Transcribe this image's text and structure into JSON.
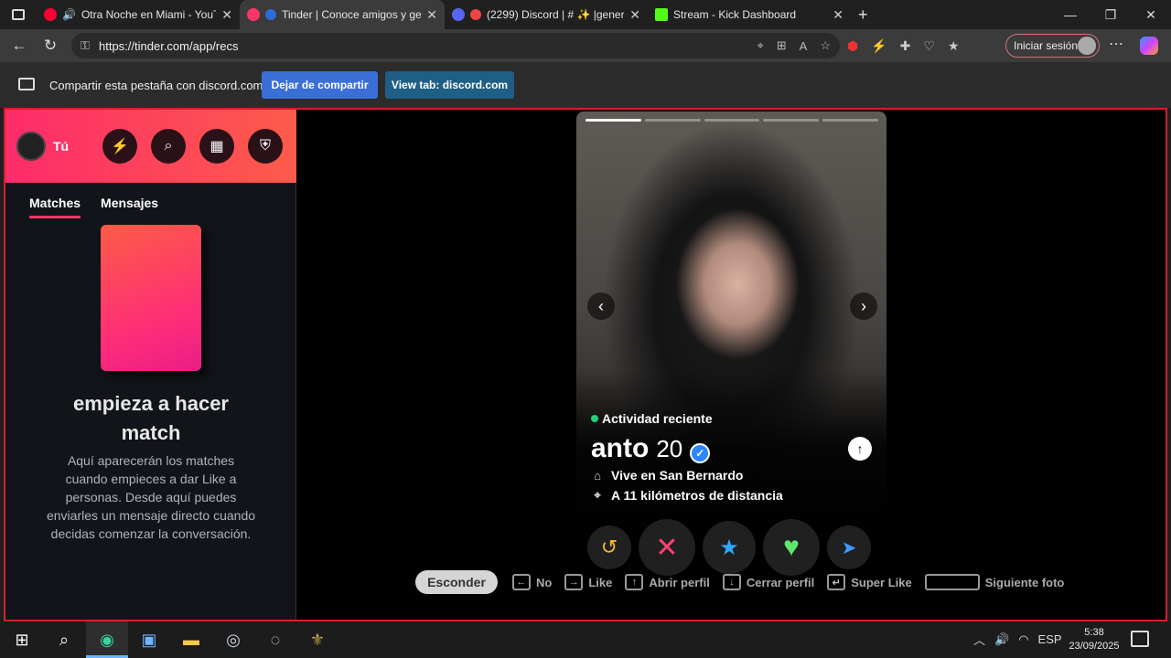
{
  "browser": {
    "tabs": [
      {
        "title": "Otra Noche en Miami - YouT",
        "favicon_color": "#ff0033",
        "active": false
      },
      {
        "title": "Tinder | Conoce amigos y ge",
        "favicon_color": "#fd3566",
        "active": true
      },
      {
        "title": "(2299) Discord | # ✨ |genera",
        "favicon_color": "#5865f2",
        "active": false
      },
      {
        "title": "Stream - Kick Dashboard",
        "favicon_color": "#53fc18",
        "active": false
      }
    ],
    "url": "https://tinder.com/app/recs",
    "signin_label": "Iniciar sesión"
  },
  "sharebar": {
    "text": "Compartir esta pestaña con discord.com",
    "stop_label": "Dejar de compartir",
    "view_label": "View tab: discord.com"
  },
  "sidebar": {
    "me_label": "Tú",
    "tabs": [
      "Matches",
      "Mensajes"
    ],
    "empty_title": "empieza a hacer match",
    "empty_text": "Aquí aparecerán los matches cuando empieces a dar Like a personas. Desde aquí puedes enviarles un mensaje directo cuando decidas comenzar la conversación."
  },
  "profile": {
    "activity": "Actividad reciente",
    "name": "anto",
    "age": "20",
    "lives": "Vive en San Bernardo",
    "distance": "A 11 kilómetros de distancia",
    "photo_count": 5,
    "current_photo": 1
  },
  "shortcuts": {
    "hide": "Esconder",
    "items": [
      {
        "key": "←",
        "label": "No"
      },
      {
        "key": "→",
        "label": "Like"
      },
      {
        "key": "↑",
        "label": "Abrir perfil"
      },
      {
        "key": "↓",
        "label": "Cerrar perfil"
      },
      {
        "key": "↵",
        "label": "Super Like"
      },
      {
        "key": "",
        "label": "Siguiente foto"
      }
    ]
  },
  "taskbar": {
    "lang": "ESP",
    "time": "5:38",
    "date": "23/09/2025"
  },
  "colors": {
    "brand_gradient_start": "#fd2b6c",
    "brand_gradient_end": "#fd5c4a",
    "active_dot": "#21d07a",
    "verified": "#2b86ff",
    "frame_red": "#d0222b"
  }
}
